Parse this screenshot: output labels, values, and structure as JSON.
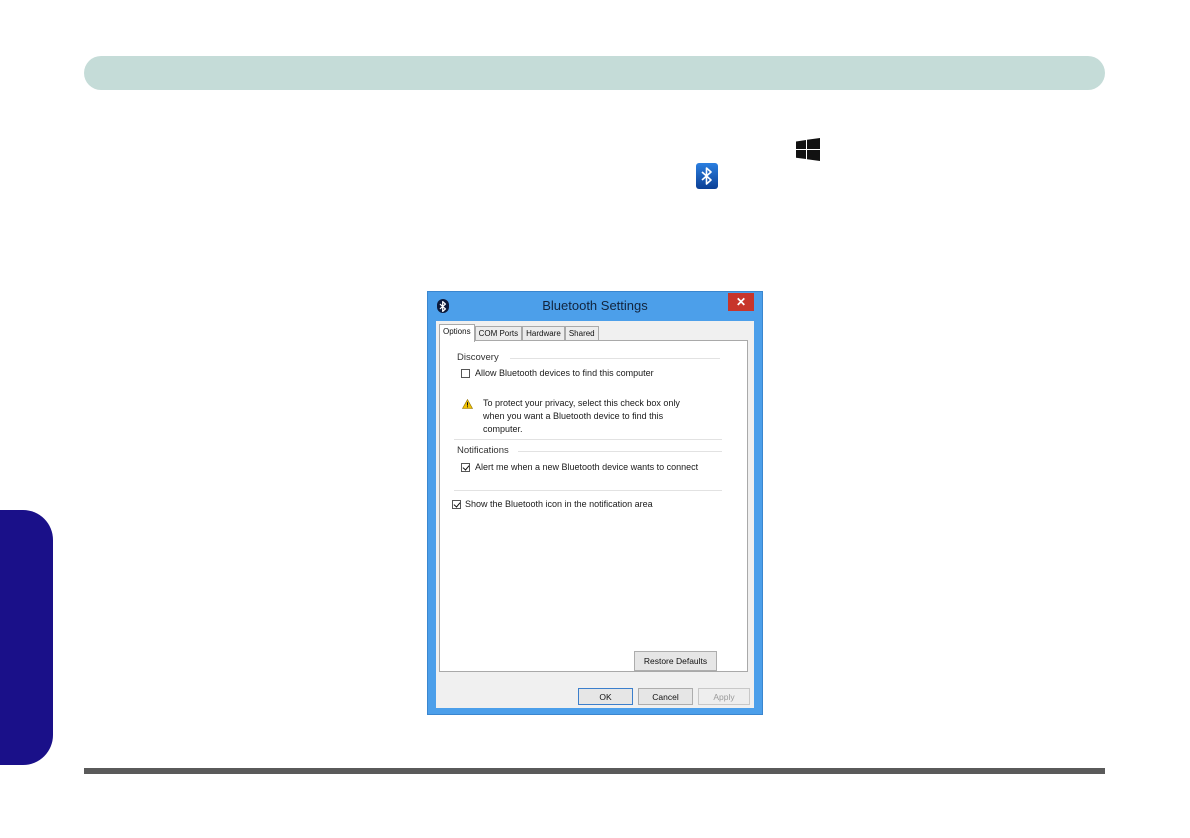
{
  "dialog": {
    "title": "Bluetooth Settings",
    "close_glyph": "✕",
    "tabs": [
      {
        "label": "Options",
        "active": true
      },
      {
        "label": "COM Ports",
        "active": false
      },
      {
        "label": "Hardware",
        "active": false
      },
      {
        "label": "Shared",
        "active": false
      }
    ],
    "discovery": {
      "heading": "Discovery",
      "allow_label": "Allow Bluetooth devices to find this computer",
      "allow_checked": false,
      "warning_lines": [
        "To protect your privacy, select this check box only",
        "when you want a Bluetooth device to find this",
        "computer."
      ]
    },
    "notifications": {
      "heading": "Notifications",
      "alert_label": "Alert me when a new Bluetooth device wants to connect",
      "alert_checked": true
    },
    "show_icon": {
      "label": "Show the Bluetooth icon in the notification area",
      "checked": true
    },
    "buttons": {
      "restore": "Restore Defaults",
      "ok": "OK",
      "cancel": "Cancel",
      "apply": "Apply"
    }
  },
  "icons": [
    "windows-logo-icon",
    "bluetooth-icon",
    "warning-icon",
    "close-icon"
  ],
  "colors": {
    "header": "#c5dcd8",
    "side_tab": "#1a1089",
    "dialog_frame": "#4c9fea",
    "close_button": "#c7352b"
  }
}
